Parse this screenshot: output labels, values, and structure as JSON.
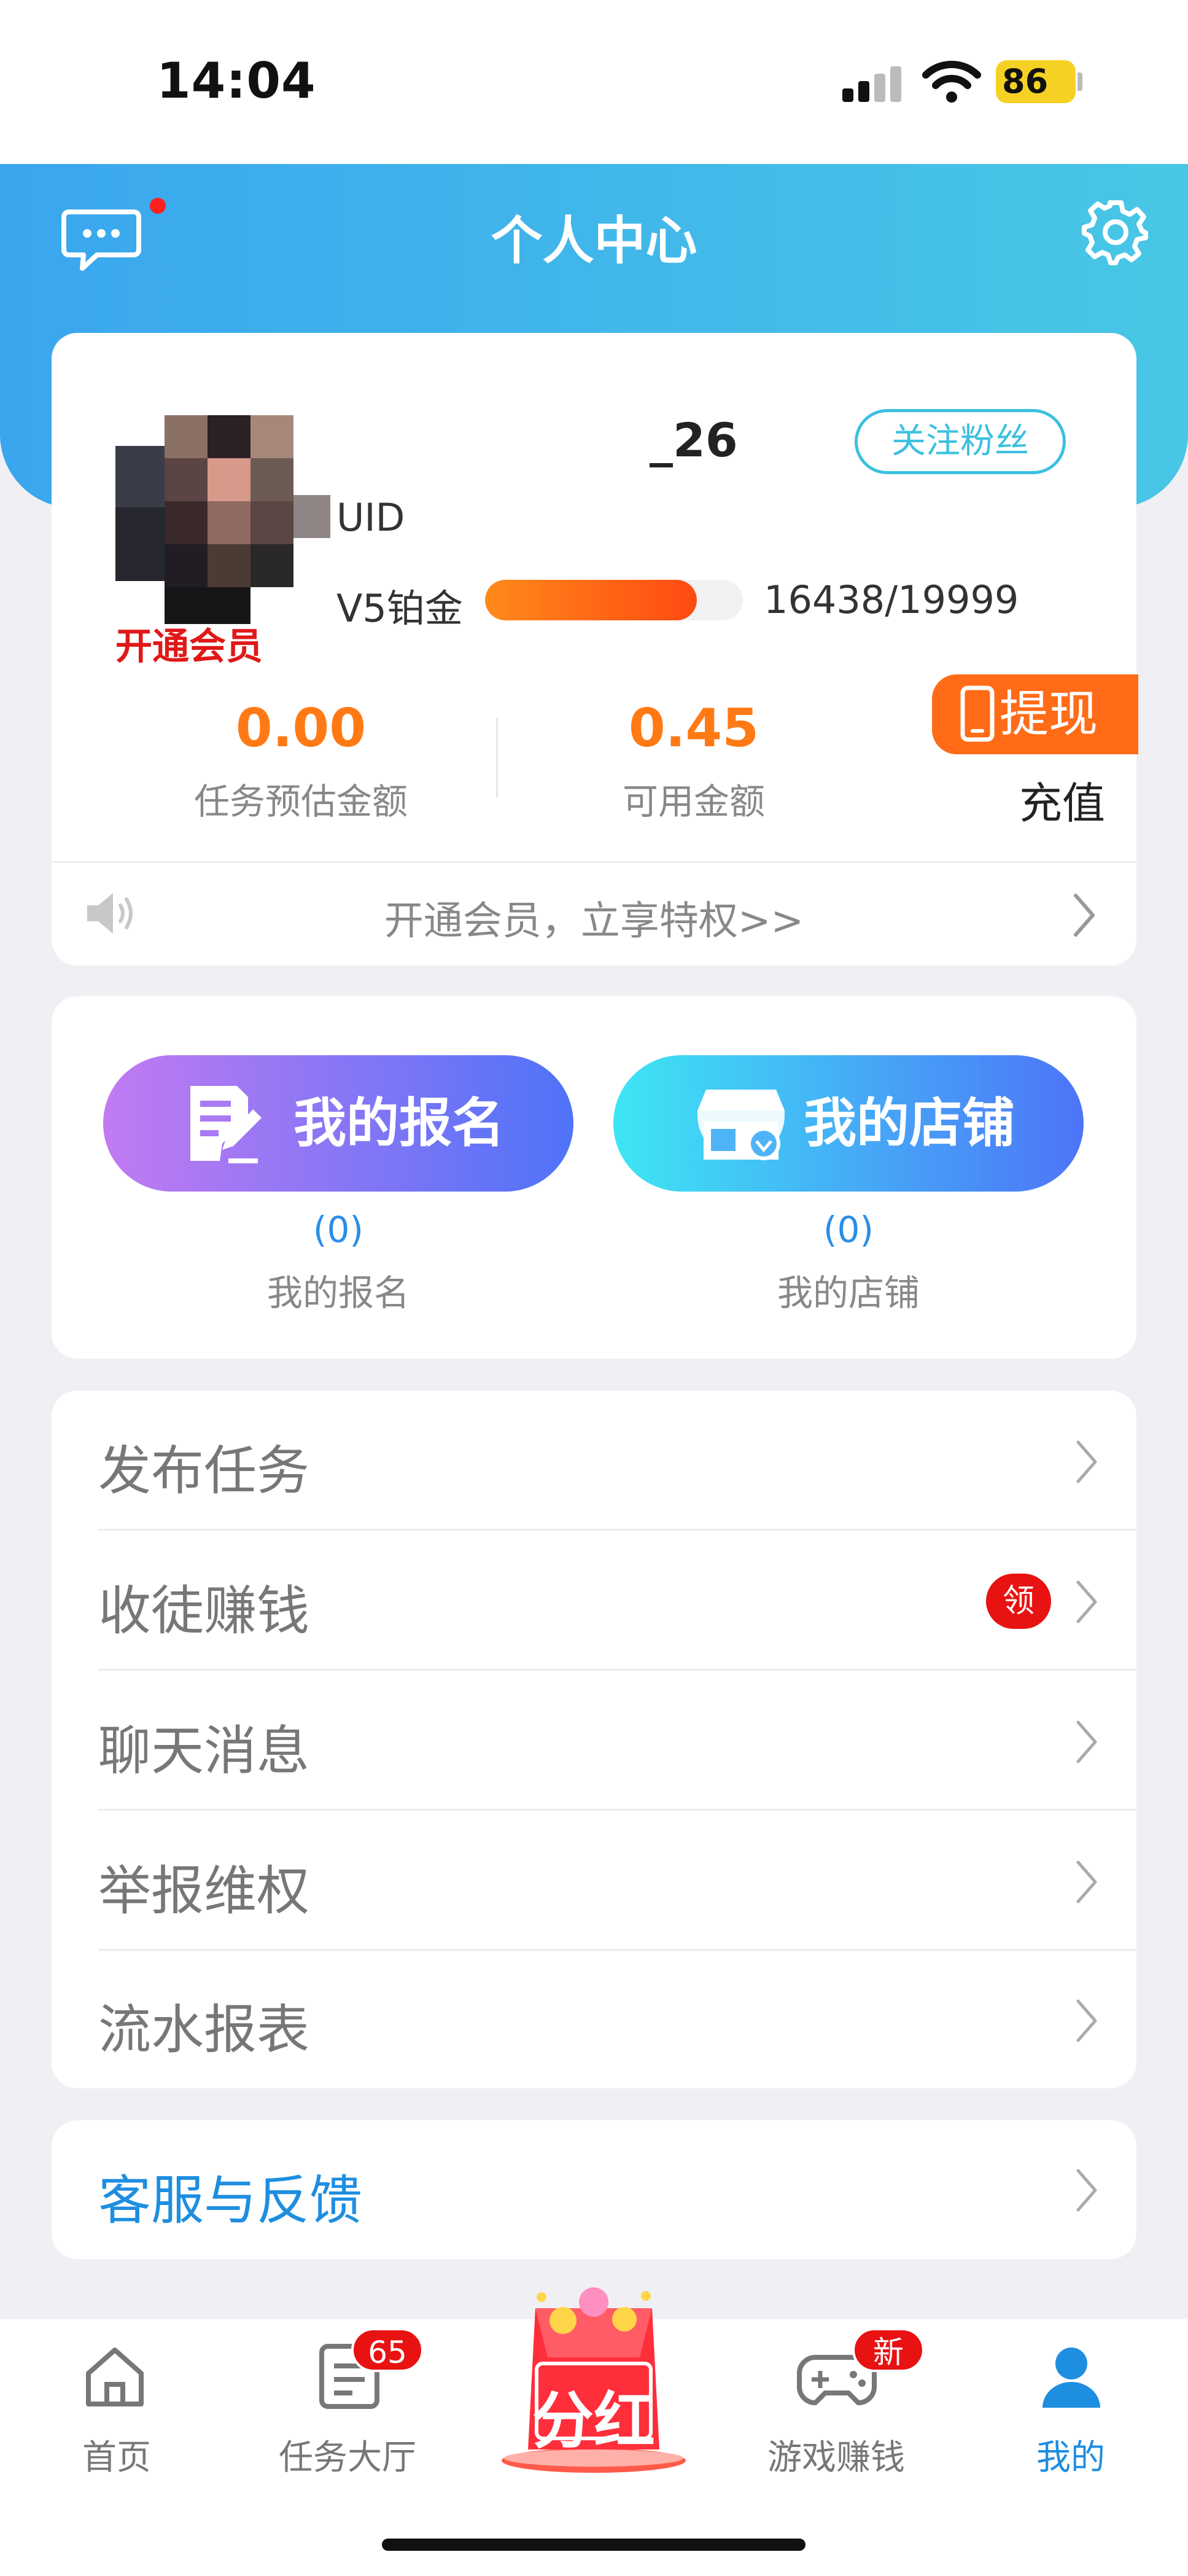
{
  "status_bar": {
    "time": "14:04",
    "battery": "86"
  },
  "header": {
    "title": "个人中心"
  },
  "profile": {
    "username": "_26",
    "follow_label": "关注粉丝",
    "uid_label": "UID",
    "level_label": "V5铂金",
    "exp_current": 16438,
    "exp_max": 19999,
    "exp_text": "16438/19999",
    "vip_open_label": "开通会员",
    "stats": [
      {
        "value": "0.00",
        "label": "任务预估金额"
      },
      {
        "value": "0.45",
        "label": "可用金额"
      }
    ],
    "withdraw_label": "提现",
    "recharge_label": "充值",
    "notice": "开通会员，立享特权>>"
  },
  "enroll": {
    "my_enroll": {
      "button_label": "我的报名",
      "count": "(0)",
      "label": "我的报名"
    },
    "my_shop": {
      "button_label": "我的店铺",
      "count": "(0)",
      "label": "我的店铺"
    }
  },
  "menu": {
    "items": [
      {
        "label": "发布任务"
      },
      {
        "label": "收徒赚钱",
        "badge": "领"
      },
      {
        "label": "聊天消息"
      },
      {
        "label": "举报维权"
      },
      {
        "label": "流水报表"
      }
    ],
    "service_label": "客服与反馈"
  },
  "tabbar": {
    "home": "首页",
    "tasks": "任务大厅",
    "tasks_badge": "65",
    "bonus": "分红",
    "games": "游戏赚钱",
    "games_badge": "新",
    "me": "我的"
  },
  "colors": {
    "accent": "#1e8ee0",
    "orange": "#ff7a14",
    "header_from": "#3aa6ee",
    "header_to": "#48c7e6"
  }
}
